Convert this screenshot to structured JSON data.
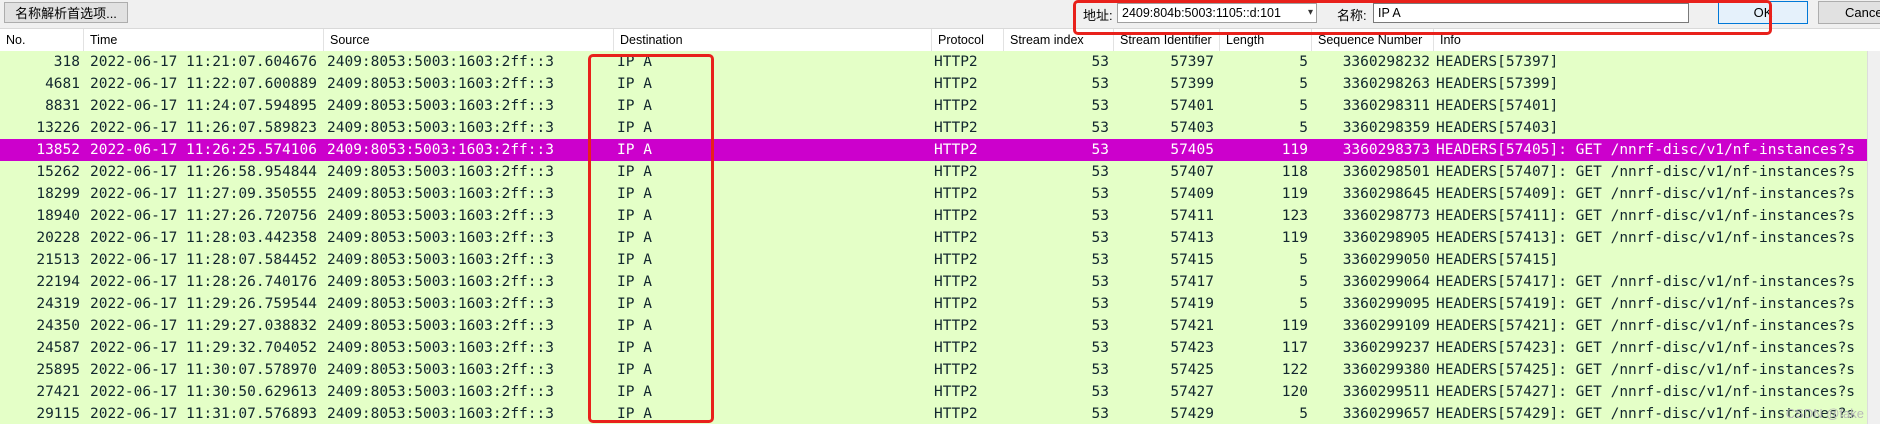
{
  "toolbar": {
    "name_resolution_btn": "名称解析首选项...",
    "address_label": "地址:",
    "address_value": "2409:804b:5003:1105::d:101",
    "name_label": "名称:",
    "name_value": "IP A",
    "ok_label": "OK",
    "cancel_label": "Cancel"
  },
  "columns": {
    "no": "No.",
    "time": "Time",
    "source": "Source",
    "destination": "Destination",
    "protocol": "Protocol",
    "stream_index": "Stream index",
    "stream_identifier": "Stream Identifier",
    "length": "Length",
    "sequence_number": "Sequence Number",
    "info": "Info"
  },
  "packets": [
    {
      "no": "318",
      "time": "2022-06-17 11:21:07.604676",
      "source": "2409:8053:5003:1603:2ff::3",
      "destination": "IP A",
      "protocol": "HTTP2",
      "stream_index": "53",
      "stream_identifier": "57397",
      "length": "5",
      "sequence_number": "3360298232",
      "info": "HEADERS[57397]"
    },
    {
      "no": "4681",
      "time": "2022-06-17 11:22:07.600889",
      "source": "2409:8053:5003:1603:2ff::3",
      "destination": "IP A",
      "protocol": "HTTP2",
      "stream_index": "53",
      "stream_identifier": "57399",
      "length": "5",
      "sequence_number": "3360298263",
      "info": "HEADERS[57399]"
    },
    {
      "no": "8831",
      "time": "2022-06-17 11:24:07.594895",
      "source": "2409:8053:5003:1603:2ff::3",
      "destination": "IP A",
      "protocol": "HTTP2",
      "stream_index": "53",
      "stream_identifier": "57401",
      "length": "5",
      "sequence_number": "3360298311",
      "info": "HEADERS[57401]"
    },
    {
      "no": "13226",
      "time": "2022-06-17 11:26:07.589823",
      "source": "2409:8053:5003:1603:2ff::3",
      "destination": "IP A",
      "protocol": "HTTP2",
      "stream_index": "53",
      "stream_identifier": "57403",
      "length": "5",
      "sequence_number": "3360298359",
      "info": "HEADERS[57403]"
    },
    {
      "no": "13852",
      "time": "2022-06-17 11:26:25.574106",
      "source": "2409:8053:5003:1603:2ff::3",
      "destination": "IP A",
      "protocol": "HTTP2",
      "stream_index": "53",
      "stream_identifier": "57405",
      "length": "119",
      "sequence_number": "3360298373",
      "info": "HEADERS[57405]: GET /nnrf-disc/v1/nf-instances?s",
      "selected": true
    },
    {
      "no": "15262",
      "time": "2022-06-17 11:26:58.954844",
      "source": "2409:8053:5003:1603:2ff::3",
      "destination": "IP A",
      "protocol": "HTTP2",
      "stream_index": "53",
      "stream_identifier": "57407",
      "length": "118",
      "sequence_number": "3360298501",
      "info": "HEADERS[57407]: GET /nnrf-disc/v1/nf-instances?s"
    },
    {
      "no": "18299",
      "time": "2022-06-17 11:27:09.350555",
      "source": "2409:8053:5003:1603:2ff::3",
      "destination": "IP A",
      "protocol": "HTTP2",
      "stream_index": "53",
      "stream_identifier": "57409",
      "length": "119",
      "sequence_number": "3360298645",
      "info": "HEADERS[57409]: GET /nnrf-disc/v1/nf-instances?s"
    },
    {
      "no": "18940",
      "time": "2022-06-17 11:27:26.720756",
      "source": "2409:8053:5003:1603:2ff::3",
      "destination": "IP A",
      "protocol": "HTTP2",
      "stream_index": "53",
      "stream_identifier": "57411",
      "length": "123",
      "sequence_number": "3360298773",
      "info": "HEADERS[57411]: GET /nnrf-disc/v1/nf-instances?s"
    },
    {
      "no": "20228",
      "time": "2022-06-17 11:28:03.442358",
      "source": "2409:8053:5003:1603:2ff::3",
      "destination": "IP A",
      "protocol": "HTTP2",
      "stream_index": "53",
      "stream_identifier": "57413",
      "length": "119",
      "sequence_number": "3360298905",
      "info": "HEADERS[57413]: GET /nnrf-disc/v1/nf-instances?s"
    },
    {
      "no": "21513",
      "time": "2022-06-17 11:28:07.584452",
      "source": "2409:8053:5003:1603:2ff::3",
      "destination": "IP A",
      "protocol": "HTTP2",
      "stream_index": "53",
      "stream_identifier": "57415",
      "length": "5",
      "sequence_number": "3360299050",
      "info": "HEADERS[57415]"
    },
    {
      "no": "22194",
      "time": "2022-06-17 11:28:26.740176",
      "source": "2409:8053:5003:1603:2ff::3",
      "destination": "IP A",
      "protocol": "HTTP2",
      "stream_index": "53",
      "stream_identifier": "57417",
      "length": "5",
      "sequence_number": "3360299064",
      "info": "HEADERS[57417]: GET /nnrf-disc/v1/nf-instances?s"
    },
    {
      "no": "24319",
      "time": "2022-06-17 11:29:26.759544",
      "source": "2409:8053:5003:1603:2ff::3",
      "destination": "IP A",
      "protocol": "HTTP2",
      "stream_index": "53",
      "stream_identifier": "57419",
      "length": "5",
      "sequence_number": "3360299095",
      "info": "HEADERS[57419]: GET /nnrf-disc/v1/nf-instances?s"
    },
    {
      "no": "24350",
      "time": "2022-06-17 11:29:27.038832",
      "source": "2409:8053:5003:1603:2ff::3",
      "destination": "IP A",
      "protocol": "HTTP2",
      "stream_index": "53",
      "stream_identifier": "57421",
      "length": "119",
      "sequence_number": "3360299109",
      "info": "HEADERS[57421]: GET /nnrf-disc/v1/nf-instances?s"
    },
    {
      "no": "24587",
      "time": "2022-06-17 11:29:32.704052",
      "source": "2409:8053:5003:1603:2ff::3",
      "destination": "IP A",
      "protocol": "HTTP2",
      "stream_index": "53",
      "stream_identifier": "57423",
      "length": "117",
      "sequence_number": "3360299237",
      "info": "HEADERS[57423]: GET /nnrf-disc/v1/nf-instances?s"
    },
    {
      "no": "25895",
      "time": "2022-06-17 11:30:07.578970",
      "source": "2409:8053:5003:1603:2ff::3",
      "destination": "IP A",
      "protocol": "HTTP2",
      "stream_index": "53",
      "stream_identifier": "57425",
      "length": "122",
      "sequence_number": "3360299380",
      "info": "HEADERS[57425]: GET /nnrf-disc/v1/nf-instances?s"
    },
    {
      "no": "27421",
      "time": "2022-06-17 11:30:50.629613",
      "source": "2409:8053:5003:1603:2ff::3",
      "destination": "IP A",
      "protocol": "HTTP2",
      "stream_index": "53",
      "stream_identifier": "57427",
      "length": "120",
      "sequence_number": "3360299511",
      "info": "HEADERS[57427]: GET /nnrf-disc/v1/nf-instances?s"
    },
    {
      "no": "29115",
      "time": "2022-06-17 11:31:07.576893",
      "source": "2409:8053:5003:1603:2ff::3",
      "destination": "IP A",
      "protocol": "HTTP2",
      "stream_index": "53",
      "stream_identifier": "57429",
      "length": "5",
      "sequence_number": "3360299657",
      "info": "HEADERS[57429]: GET /nnrf-disc/v1/nf-instances?s"
    }
  ],
  "colors": {
    "row_background": "#e4ffc7",
    "selected_background": "#cc00cc",
    "highlight_box": "#e8211b"
  },
  "watermark": "CSDN @fake"
}
